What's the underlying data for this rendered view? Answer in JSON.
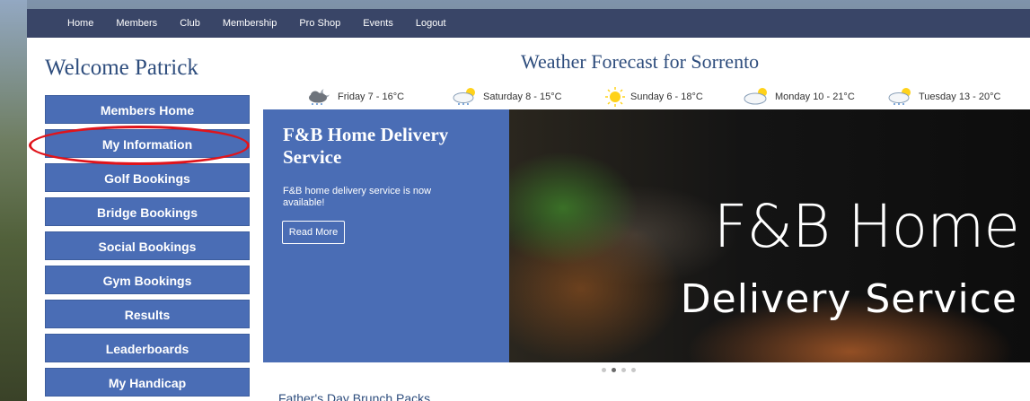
{
  "nav": {
    "items": [
      {
        "label": "Home"
      },
      {
        "label": "Members"
      },
      {
        "label": "Club"
      },
      {
        "label": "Membership"
      },
      {
        "label": "Pro Shop"
      },
      {
        "label": "Events"
      },
      {
        "label": "Logout"
      }
    ]
  },
  "welcome": "Welcome Patrick",
  "sidebar": {
    "items": [
      {
        "label": "Members Home"
      },
      {
        "label": "My Information"
      },
      {
        "label": "Golf Bookings"
      },
      {
        "label": "Bridge Bookings"
      },
      {
        "label": "Social Bookings"
      },
      {
        "label": "Gym Bookings"
      },
      {
        "label": "Results"
      },
      {
        "label": "Leaderboards"
      },
      {
        "label": "My Handicap"
      }
    ],
    "highlighted": "My Information",
    "highlight_color": "#e0141b"
  },
  "weather": {
    "title": "Weather Forecast for Sorrento",
    "days": [
      {
        "label": "Friday 7 - 16°C",
        "icon": "night-rain-cloud-icon"
      },
      {
        "label": "Saturday 8 - 15°C",
        "icon": "sun-rain-cloud-icon"
      },
      {
        "label": "Sunday 6 - 18°C",
        "icon": "sun-icon"
      },
      {
        "label": "Monday 10 - 21°C",
        "icon": "sun-cloud-icon"
      },
      {
        "label": "Tuesday 13 - 20°C",
        "icon": "sun-rain-cloud-icon"
      }
    ]
  },
  "carousel": {
    "title": "F&B Home Delivery Service",
    "text": "F&B home delivery service is now available!",
    "button": "Read More",
    "image_line1": "F&B Home",
    "image_line2": "Delivery Service",
    "slide_count": 4,
    "active_slide": 2
  },
  "below_title": "Father's Day Brunch Packs",
  "colors": {
    "nav_bg": "#394567",
    "accent_blue": "#4a6db5",
    "heading_blue": "#2e4d7d"
  }
}
